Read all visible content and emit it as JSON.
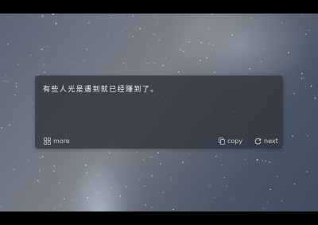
{
  "quote": {
    "text": "有些人光是遇到就已经赚到了。"
  },
  "actions": {
    "more_label": "more",
    "copy_label": "copy",
    "next_label": "next"
  },
  "icons": {
    "more": "grid-icon",
    "copy": "copy-icon",
    "next": "refresh-icon"
  },
  "colors": {
    "card_bg": "#32363e",
    "text": "#f1f2f4",
    "action_text": "#c8ccd3",
    "letterbox": "#000000"
  }
}
